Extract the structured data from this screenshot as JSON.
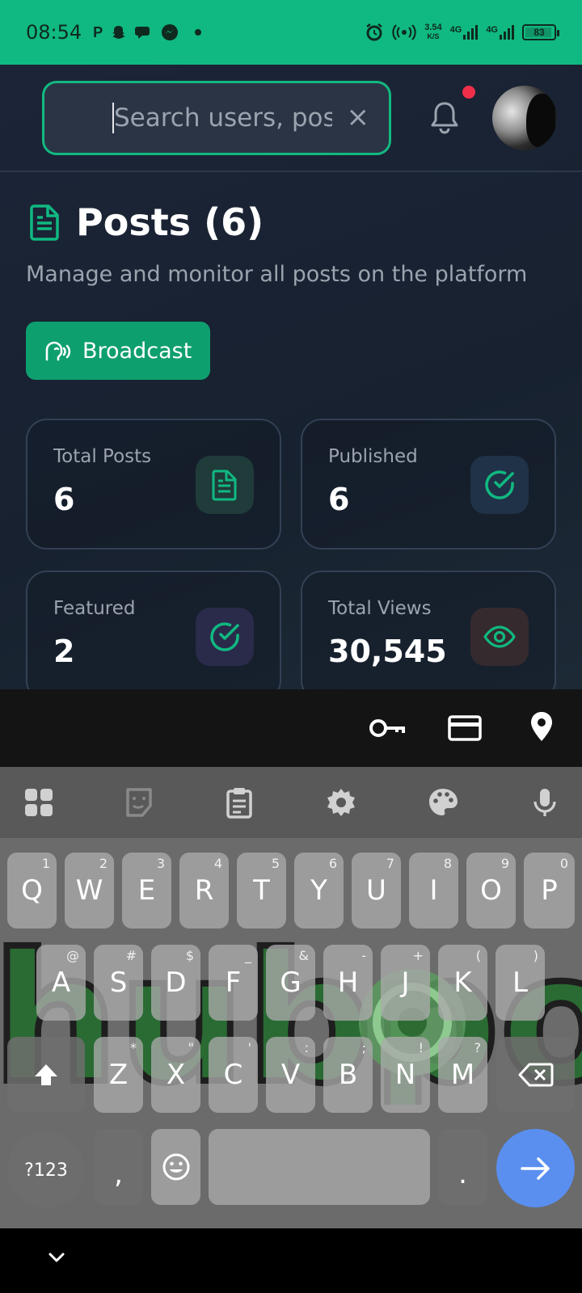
{
  "status_bar": {
    "time": "08:54",
    "left_icons": [
      "parking-icon",
      "snapchat-icon",
      "messages-icon",
      "messenger-icon",
      "dot-icon"
    ],
    "right_icons": [
      "alarm-icon",
      "hotspot-icon",
      "network-speed-icon",
      "signal-4g-icon",
      "signal-4g-icon",
      "battery-icon"
    ],
    "net_speed": "3.54",
    "net_unit": "K/S",
    "sig1": "4G",
    "sig2": "4G",
    "battery": "83"
  },
  "header": {
    "search_placeholder": "Search users, pos",
    "clear": "×"
  },
  "page": {
    "title": "Posts (6)",
    "subtitle": "Manage and monitor all posts on the platform",
    "broadcast_label": "Broadcast"
  },
  "stats": [
    {
      "label": "Total Posts",
      "value": "6",
      "icon": "document-icon",
      "icon_bg": "#1f3b3a",
      "icon_color": "#10b981"
    },
    {
      "label": "Published",
      "value": "6",
      "icon": "check-circle-icon",
      "icon_bg": "#1f3247",
      "icon_color": "#10b981"
    },
    {
      "label": "Featured",
      "value": "2",
      "icon": "check-circle-icon",
      "icon_bg": "#2a2b4a",
      "icon_color": "#10b981"
    },
    {
      "label": "Total Views",
      "value": "30,545",
      "icon": "eye-icon",
      "icon_bg": "#352a2d",
      "icon_color": "#10b981"
    }
  ],
  "autofill": [
    "key-icon",
    "card-icon",
    "location-pin-icon"
  ],
  "keyboard": {
    "toolbar": [
      "apps-grid-icon",
      "sticker-icon",
      "clipboard-icon",
      "settings-icon",
      "palette-icon",
      "mic-icon"
    ],
    "row1": [
      [
        "Q",
        "1"
      ],
      [
        "W",
        "2"
      ],
      [
        "E",
        "3"
      ],
      [
        "R",
        "4"
      ],
      [
        "T",
        "5"
      ],
      [
        "Y",
        "6"
      ],
      [
        "U",
        "7"
      ],
      [
        "I",
        "8"
      ],
      [
        "O",
        "9"
      ],
      [
        "P",
        "0"
      ]
    ],
    "row2": [
      [
        "A",
        "@"
      ],
      [
        "S",
        "#"
      ],
      [
        "D",
        "$"
      ],
      [
        "F",
        "_"
      ],
      [
        "G",
        "&"
      ],
      [
        "H",
        "-"
      ],
      [
        "J",
        "+"
      ],
      [
        "K",
        "("
      ],
      [
        "L",
        ")"
      ]
    ],
    "row3": [
      [
        "Z",
        "*"
      ],
      [
        "X",
        "\""
      ],
      [
        "C",
        "'"
      ],
      [
        "V",
        ":"
      ],
      [
        "B",
        ";"
      ],
      [
        "N",
        "!"
      ],
      [
        "M",
        "?"
      ]
    ],
    "sym_label": "?123",
    "comma": ",",
    "period": ".",
    "watermark_text": "hubpost"
  },
  "colors": {
    "accent": "#10b981",
    "background": "#1a2333",
    "notification_dot": "#ef2f4a",
    "enter_key": "#5a8ff0"
  }
}
